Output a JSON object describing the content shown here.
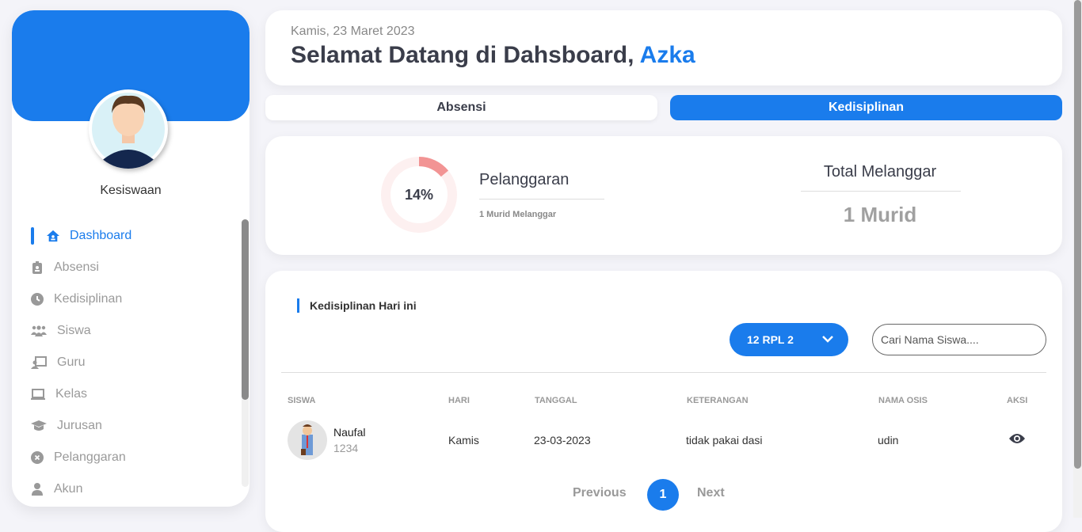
{
  "sidebar": {
    "role": "Kesiswaan",
    "items": [
      {
        "label": "Dashboard",
        "icon": "home-icon",
        "active": true
      },
      {
        "label": "Absensi",
        "icon": "id-badge-icon"
      },
      {
        "label": "Kedisiplinan",
        "icon": "clock-icon"
      },
      {
        "label": "Siswa",
        "icon": "users-icon"
      },
      {
        "label": "Guru",
        "icon": "chalkboard-teacher-icon"
      },
      {
        "label": "Kelas",
        "icon": "laptop-icon"
      },
      {
        "label": "Jurusan",
        "icon": "graduation-cap-icon"
      },
      {
        "label": "Pelanggaran",
        "icon": "times-circle-icon"
      },
      {
        "label": "Akun",
        "icon": "user-icon"
      }
    ]
  },
  "header": {
    "date": "Kamis, 23 Maret 2023",
    "greeting": "Selamat Datang di Dahsboard,",
    "name": "Azka"
  },
  "tabs": [
    {
      "label": "Absensi"
    },
    {
      "label": "Kedisiplinan",
      "active": true
    }
  ],
  "stats": {
    "percent_label": "14%",
    "percent": 14,
    "pelanggaran_title": "Pelanggaran",
    "pelanggaran_sub": "1 Murid Melanggar",
    "total_title": "Total Melanggar",
    "total_value": "1 Murid"
  },
  "table": {
    "section_title": "Kedisiplinan Hari ini",
    "class_select": "12 RPL 2",
    "search_placeholder": "Cari Nama Siswa....",
    "headers": [
      "SISWA",
      "HARI",
      "TANGGAL",
      "KETERANGAN",
      "NAMA OSIS",
      "AKSI"
    ],
    "rows": [
      {
        "name": "Naufal",
        "id": "1234",
        "hari": "Kamis",
        "tanggal": "23-03-2023",
        "keterangan": "tidak pakai dasi",
        "osis": "udin"
      }
    ]
  },
  "pagination": {
    "previous": "Previous",
    "page": "1",
    "next": "Next"
  },
  "colors": {
    "accent": "#1a7cec",
    "donut": "#f29494"
  }
}
